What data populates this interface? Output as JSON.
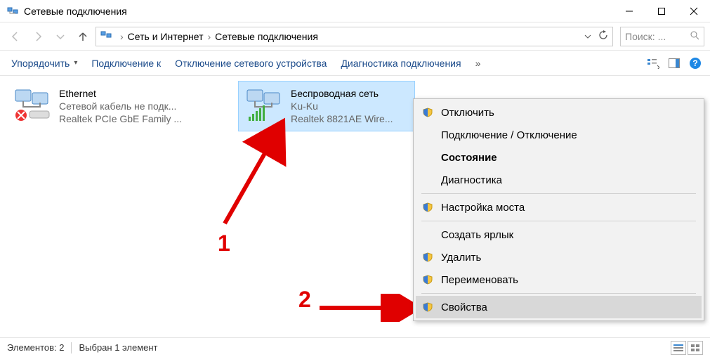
{
  "window": {
    "title": "Сетевые подключения"
  },
  "breadcrumb": {
    "parent": "Сеть и Интернет",
    "current": "Сетевые подключения"
  },
  "search": {
    "placeholder": "Поиск: ..."
  },
  "toolbar": {
    "organize": "Упорядочить",
    "connect": "Подключение к",
    "disable": "Отключение сетевого устройства",
    "diagnose": "Диагностика подключения",
    "overflow": "»"
  },
  "items": [
    {
      "title": "Ethernet",
      "sub1": "Сетевой кабель не подк...",
      "sub2": "Realtek PCIe GbE Family ...",
      "selected": false,
      "disconnected": true
    },
    {
      "title": "Беспроводная сеть",
      "sub1": "Ku-Ku",
      "sub2": "Realtek 8821AE Wire...",
      "selected": true,
      "disconnected": false
    }
  ],
  "context_menu": [
    {
      "label": "Отключить",
      "shield": true
    },
    {
      "label": "Подключение / Отключение",
      "shield": false
    },
    {
      "label": "Состояние",
      "shield": false,
      "bold": true
    },
    {
      "label": "Диагностика",
      "shield": false
    },
    {
      "sep": true
    },
    {
      "label": "Настройка моста",
      "shield": true
    },
    {
      "sep": true
    },
    {
      "label": "Создать ярлык",
      "shield": false
    },
    {
      "label": "Удалить",
      "shield": true
    },
    {
      "label": "Переименовать",
      "shield": true
    },
    {
      "sep": true
    },
    {
      "label": "Свойства",
      "shield": true,
      "highlight": true
    }
  ],
  "status": {
    "count_label": "Элементов: 2",
    "selection_label": "Выбран 1 элемент"
  },
  "annotations": {
    "num1": "1",
    "num2": "2"
  }
}
